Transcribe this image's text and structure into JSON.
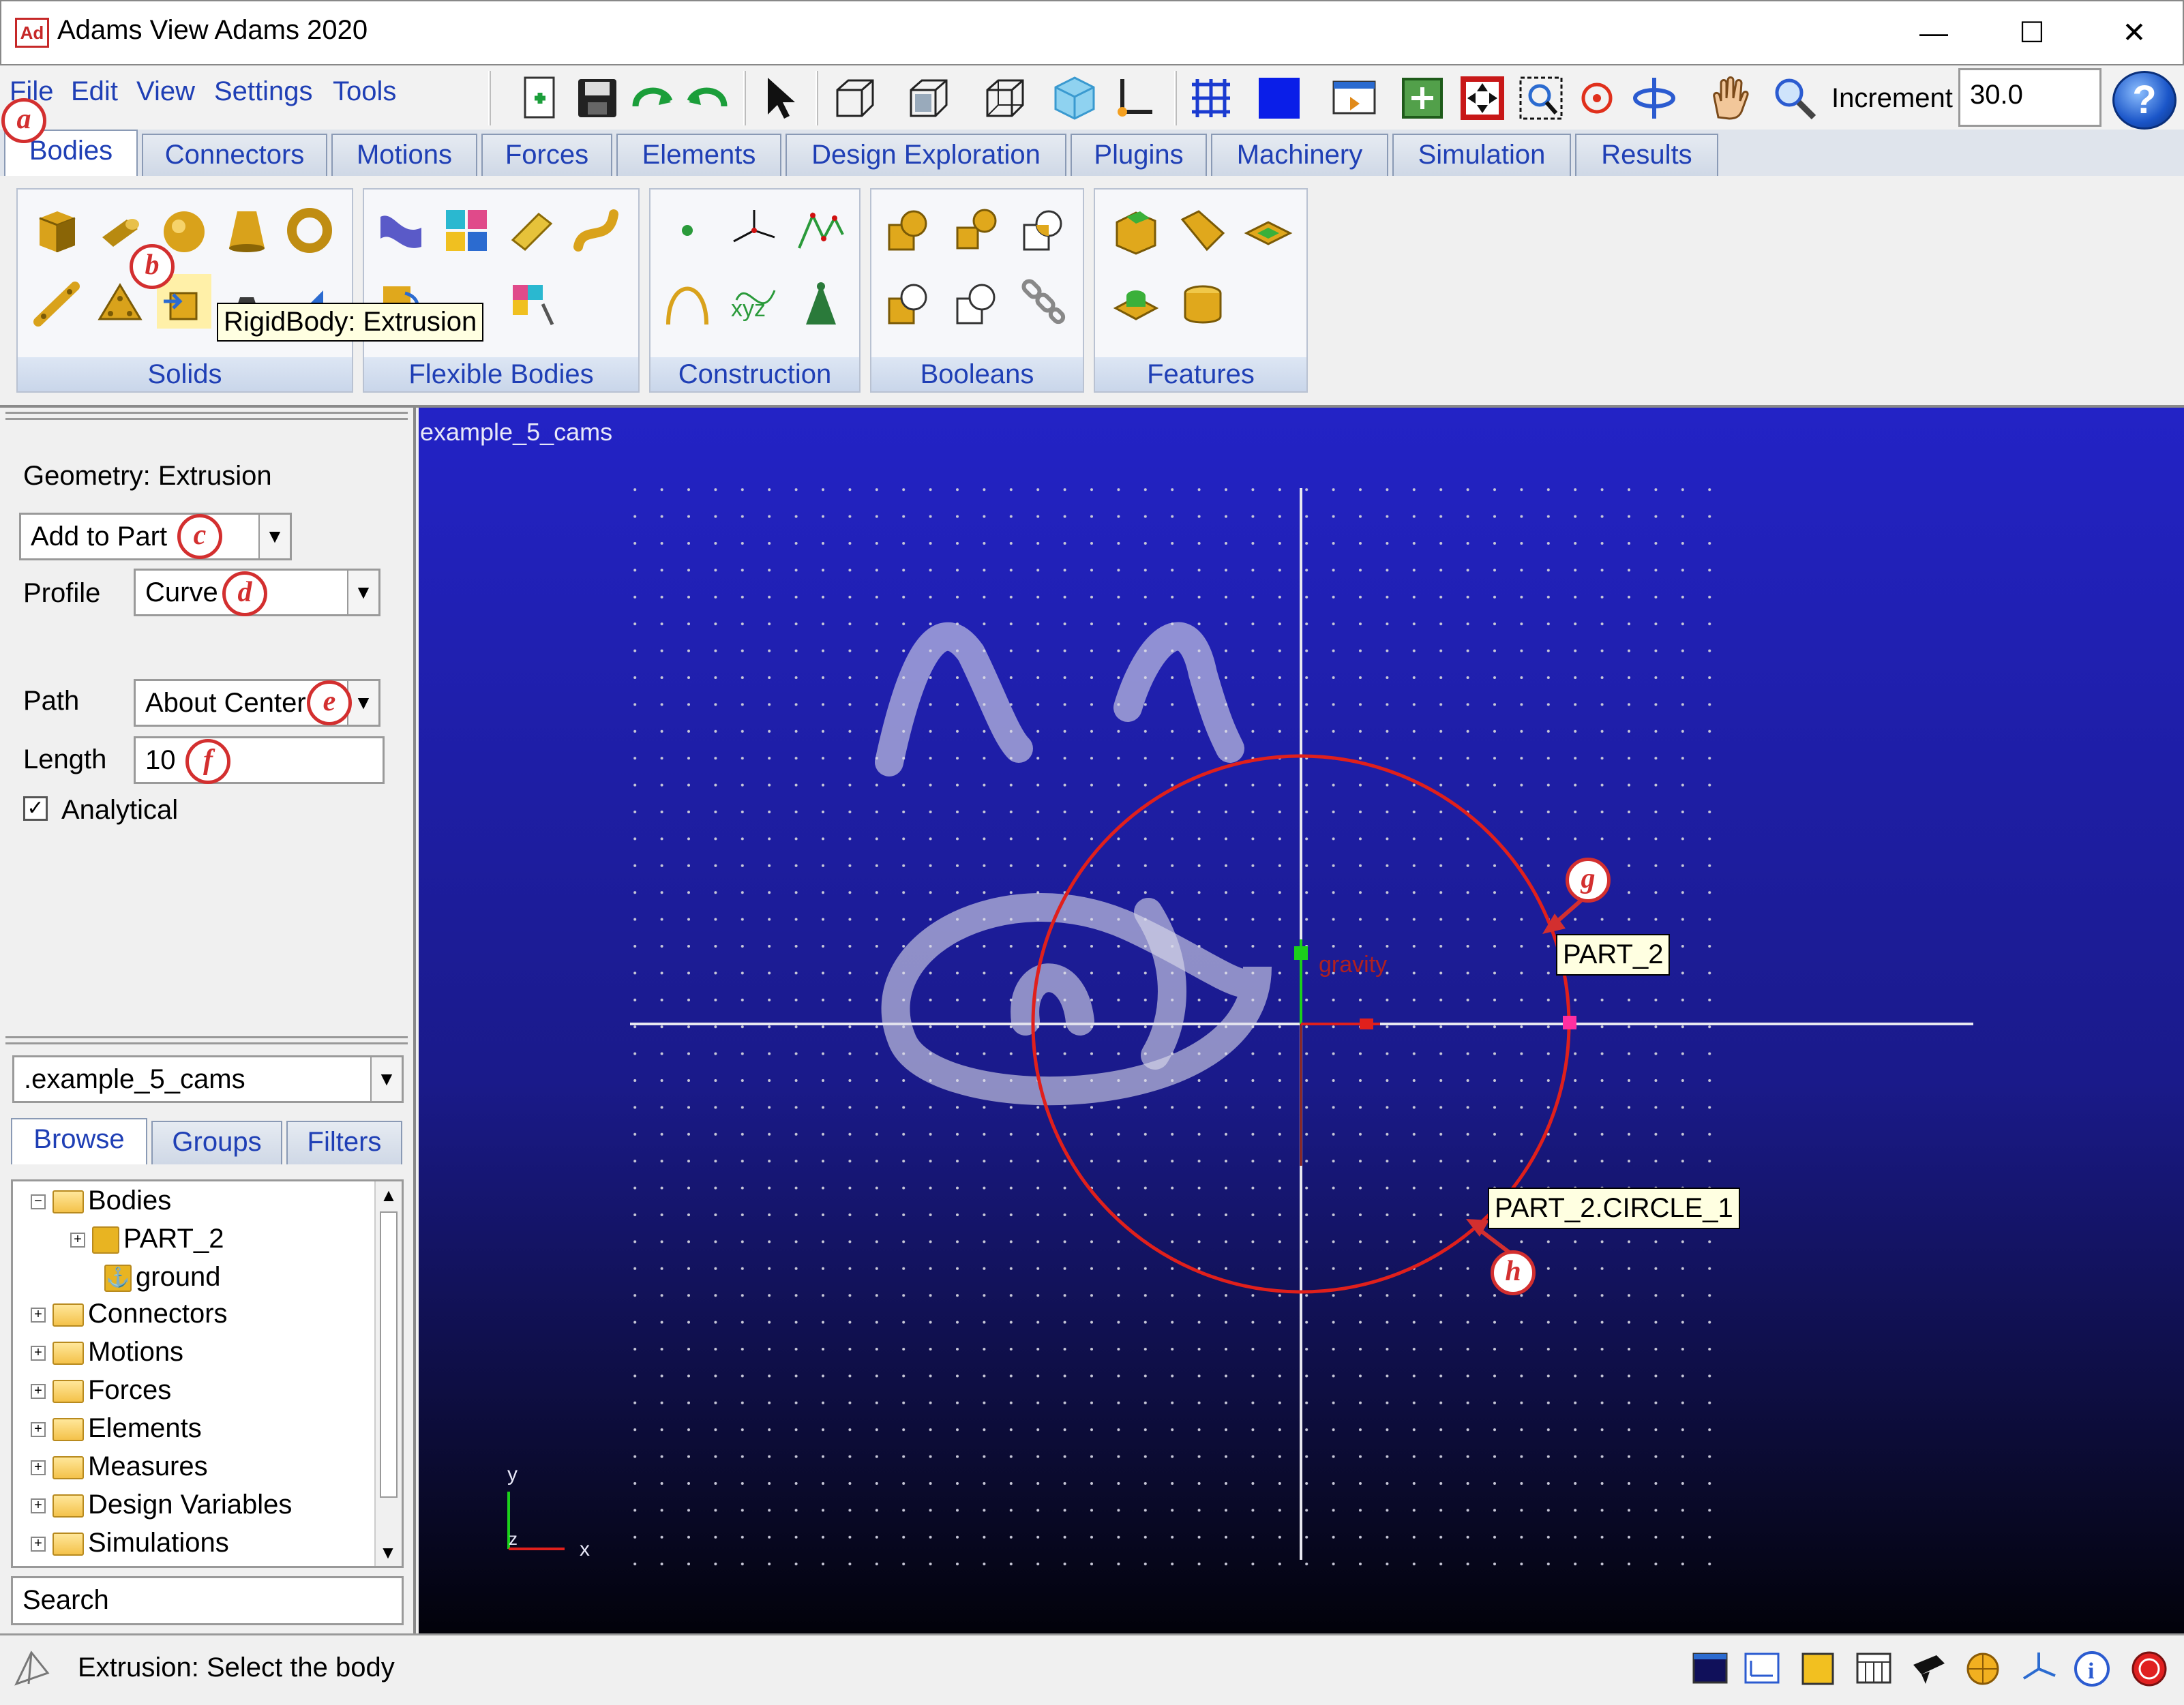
{
  "window": {
    "title": "Adams View Adams 2020",
    "icon_text": "Ad",
    "controls": {
      "minimize": "—",
      "maximize": "☐",
      "close": "✕"
    }
  },
  "menu": [
    "File",
    "Edit",
    "View",
    "Settings",
    "Tools"
  ],
  "toolbar": {
    "increment_label": "Increment",
    "increment_value": "30.0",
    "help": "?"
  },
  "tabs": [
    "Bodies",
    "Connectors",
    "Motions",
    "Forces",
    "Elements",
    "Design Exploration",
    "Plugins",
    "Machinery",
    "Simulation",
    "Results"
  ],
  "ribbon_groups": [
    "Solids",
    "Flexible Bodies",
    "Construction",
    "Booleans",
    "Features"
  ],
  "tooltip": "RigidBody: Extrusion",
  "panel": {
    "title": "Geometry: Extrusion",
    "mode": "Add to Part",
    "profile_label": "Profile",
    "profile_value": "Curve",
    "path_label": "Path",
    "path_value": "About Center",
    "length_label": "Length",
    "length_value": "10",
    "analytical_label": "Analytical",
    "analytical_checked": true
  },
  "browser": {
    "model": ".example_5_cams",
    "tabs": [
      "Browse",
      "Groups",
      "Filters"
    ],
    "tree": [
      "Bodies",
      "PART_2",
      "ground",
      "Connectors",
      "Motions",
      "Forces",
      "Elements",
      "Measures",
      "Design Variables",
      "Simulations"
    ],
    "search": "Search"
  },
  "viewport": {
    "model_name": "example_5_cams",
    "gravity_label": "gravity",
    "label_part": "PART_2",
    "label_circle": "PART_2.CIRCLE_1",
    "axis_y": "y",
    "axis_x": "x",
    "axis_z": "z"
  },
  "annotations": [
    "a",
    "b",
    "c",
    "d",
    "e",
    "f",
    "g",
    "h"
  ],
  "status": {
    "text": "Extrusion: Select the body"
  },
  "colors": {
    "accent": "#1f3fb5",
    "annotation": "#d32f2f",
    "curve": "#e0201c"
  }
}
